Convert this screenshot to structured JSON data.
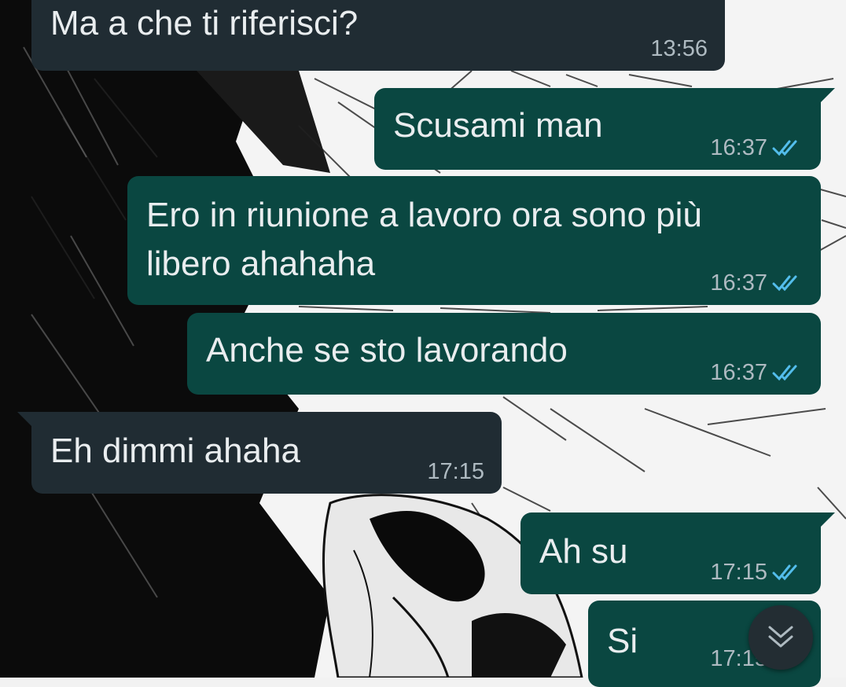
{
  "colors": {
    "incoming_bubble": "#202c33",
    "outgoing_bubble": "#0a4741",
    "message_text": "#e9edef",
    "meta_text": "#aebac1",
    "read_ticks": "#53bdeb"
  },
  "messages": [
    {
      "direction": "incoming",
      "text": "Ma a che ti riferisci?",
      "time": "13:56"
    },
    {
      "direction": "outgoing",
      "text": "Scusami man",
      "time": "16:37",
      "status": "read"
    },
    {
      "direction": "outgoing",
      "text_line1": "Ero in riunione a lavoro ora sono più",
      "text_line2": "libero ahahaha",
      "time": "16:37",
      "status": "read"
    },
    {
      "direction": "outgoing",
      "text": "Anche se sto lavorando",
      "time": "16:37",
      "status": "read"
    },
    {
      "direction": "incoming",
      "text": "Eh dimmi ahaha",
      "time": "17:15"
    },
    {
      "direction": "outgoing",
      "text": "Ah su",
      "time": "17:15",
      "status": "read"
    },
    {
      "direction": "outgoing",
      "text": "Si",
      "time": "17:15",
      "status": "read"
    }
  ],
  "scroll_button": {
    "icon": "double-chevron-down-icon"
  }
}
